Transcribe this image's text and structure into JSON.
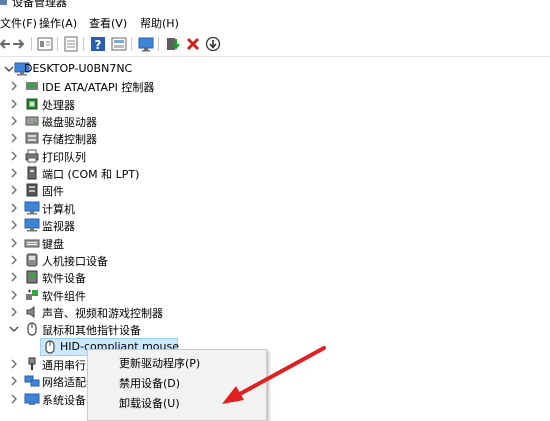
{
  "window": {
    "title": "设备管理器"
  },
  "menu": [
    {
      "label": "文件(F)"
    },
    {
      "label": "操作(A)"
    },
    {
      "label": "查看(V)"
    },
    {
      "label": "帮助(H)"
    }
  ],
  "toolbar": {
    "icons": [
      "back-arrow-icon",
      "forward-arrow-icon",
      "device-list-icon",
      "properties-icon",
      "help-icon",
      "view-icon",
      "monitor-icon",
      "update-driver-icon",
      "uninstall-x-icon",
      "scan-down-icon"
    ]
  },
  "tree": {
    "root": "DESKTOP-U0BN7NC",
    "items": [
      {
        "label": "IDE ATA/ATAPI 控制器",
        "icon": "ide-controller-icon"
      },
      {
        "label": "处理器",
        "icon": "processor-icon"
      },
      {
        "label": "磁盘驱动器",
        "icon": "disk-drive-icon"
      },
      {
        "label": "存储控制器",
        "icon": "storage-controller-icon"
      },
      {
        "label": "打印队列",
        "icon": "printer-icon"
      },
      {
        "label": "端口 (COM 和 LPT)",
        "icon": "port-icon"
      },
      {
        "label": "固件",
        "icon": "firmware-icon"
      },
      {
        "label": "计算机",
        "icon": "computer-icon"
      },
      {
        "label": "监视器",
        "icon": "monitor-icon"
      },
      {
        "label": "键盘",
        "icon": "keyboard-icon"
      },
      {
        "label": "人机接口设备",
        "icon": "hid-icon"
      },
      {
        "label": "软件设备",
        "icon": "software-device-icon"
      },
      {
        "label": "软件组件",
        "icon": "software-component-icon"
      },
      {
        "label": "声音、视频和游戏控制器",
        "icon": "sound-icon"
      },
      {
        "label": "鼠标和其他指针设备",
        "icon": "mouse-icon",
        "expanded": true
      },
      {
        "label": "HID-compliant mouse",
        "icon": "mouse-icon",
        "child": true,
        "selected": true
      },
      {
        "label": "通用串行总",
        "icon": "usb-icon"
      },
      {
        "label": "网络适配器",
        "icon": "network-icon"
      },
      {
        "label": "系统设备",
        "icon": "system-device-icon"
      }
    ]
  },
  "context_menu": {
    "items": [
      {
        "label": "更新驱动程序(P)"
      },
      {
        "label": "禁用设备(D)"
      },
      {
        "label": "卸载设备(U)"
      }
    ]
  },
  "colors": {
    "selection": "#cce8ff",
    "annotation_arrow": "#e02020"
  }
}
